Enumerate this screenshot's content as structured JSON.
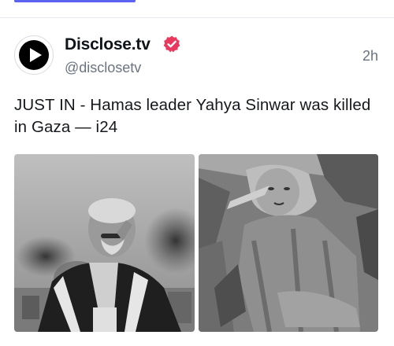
{
  "post": {
    "author_name": "Disclose.tv",
    "handle": "@disclosetv",
    "timestamp": "2h",
    "verified": true,
    "text": "JUST IN - Hamas leader Yahya Sinwar was killed in Gaza — i24",
    "media": [
      {
        "kind": "photo",
        "description_icon": "photo-speaker-icon"
      },
      {
        "kind": "photo",
        "description_icon": "photo-rubble-icon"
      }
    ]
  },
  "colors": {
    "accent": "#5b63f0",
    "verified_badge": "#e9395f",
    "secondary_text": "#6b7380"
  }
}
